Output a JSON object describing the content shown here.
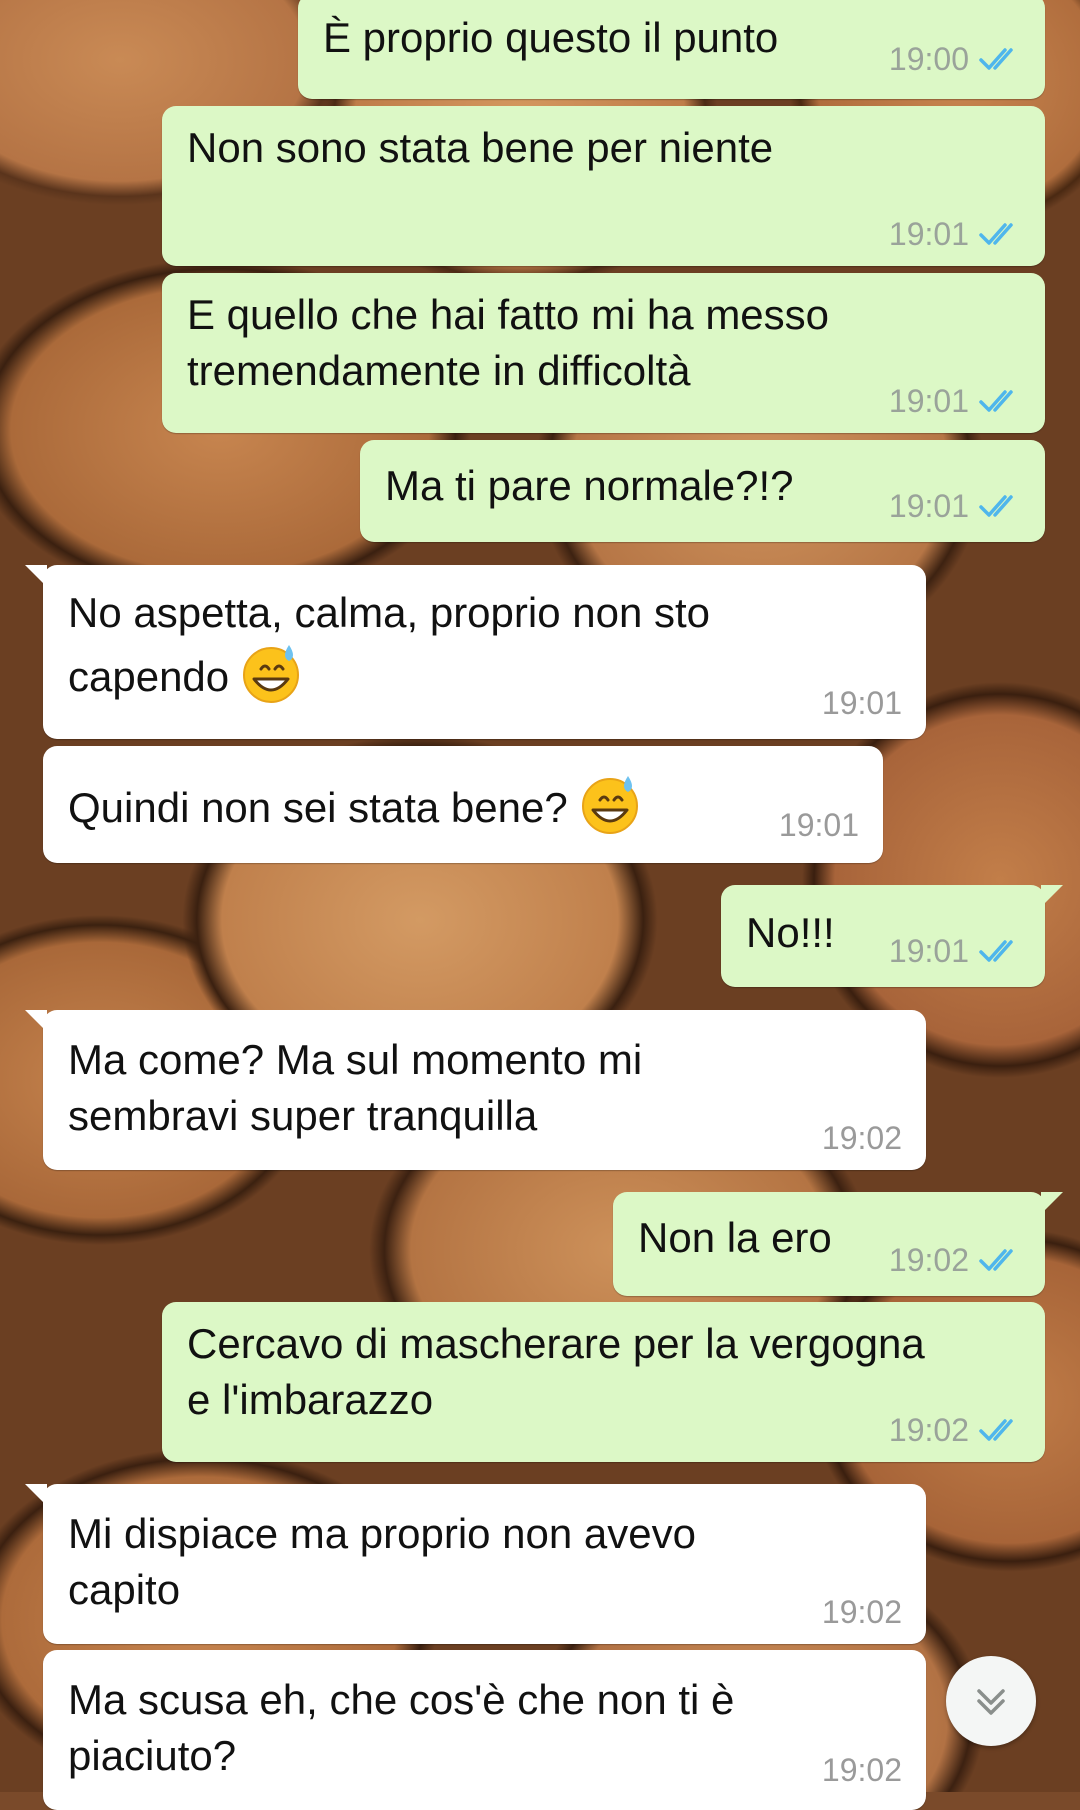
{
  "chat": {
    "messages": [
      {
        "direction": "out",
        "text": "È proprio questo il punto",
        "time": "19:00",
        "status": "read"
      },
      {
        "direction": "out",
        "text": "Non sono stata bene per niente",
        "time": "19:01",
        "status": "read"
      },
      {
        "direction": "out",
        "text": "E quello che hai fatto mi ha messo\ntremendamente in difficoltà",
        "time": "19:01",
        "status": "read"
      },
      {
        "direction": "out",
        "text": "Ma ti pare normale?!?",
        "time": "19:01",
        "status": "read"
      },
      {
        "direction": "in",
        "text": "No aspetta, calma, proprio non sto\ncapendo",
        "emoji": "grinning-sweat-emoji",
        "time": "19:01"
      },
      {
        "direction": "in",
        "text": "Quindi non sei stata bene?",
        "emoji": "grinning-sweat-emoji",
        "time": "19:01"
      },
      {
        "direction": "out",
        "text": "No!!!",
        "time": "19:01",
        "status": "read"
      },
      {
        "direction": "in",
        "text": "Ma come? Ma sul momento mi\nsembravi super tranquilla",
        "time": "19:02"
      },
      {
        "direction": "out",
        "text": "Non la ero",
        "time": "19:02",
        "status": "read"
      },
      {
        "direction": "out",
        "text": "Cercavo di mascherare per la vergogna\ne l'imbarazzo",
        "time": "19:02",
        "status": "read"
      },
      {
        "direction": "in",
        "text": "Mi dispiace ma proprio non avevo\ncapito",
        "time": "19:02"
      },
      {
        "direction": "in",
        "text": "Ma scusa eh, che cos'è che non ti è\npiaciuto?",
        "time": "19:02"
      }
    ]
  },
  "icons": {
    "read_receipt": "double-check-icon",
    "scroll_down": "chevron-double-down-icon"
  },
  "colors": {
    "outgoing_bubble": "#dcf8c6",
    "incoming_bubble": "#ffffff",
    "read_check": "#4fb6ec",
    "timestamp": "#9a9a9a"
  }
}
